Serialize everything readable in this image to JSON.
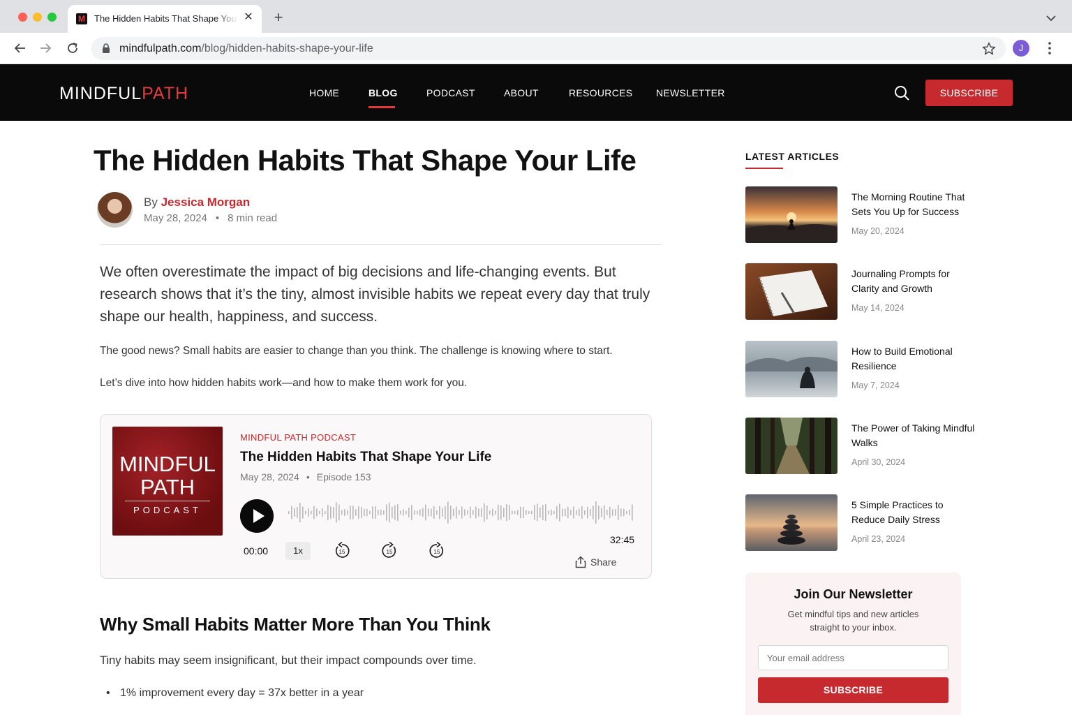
{
  "browser": {
    "tab_title": "The Hidden Habits That Shape Your Life",
    "tab_favicon": "M",
    "url_domain": "mindfulpath.com",
    "url_path": "/blog/hidden-habits-shape-your-life",
    "profile_initial": "J"
  },
  "site": {
    "logo_part1": "MINDFUL",
    "logo_part2": "PATH",
    "nav": [
      "HOME",
      "BLOG",
      "PODCAST",
      "ABOUT",
      "RESOURCES",
      "NEWSLETTER"
    ],
    "active_nav": "BLOG",
    "subscribe_label": "SUBSCRIBE",
    "accent_color": "#c62a2f"
  },
  "article": {
    "title": "The Hidden Habits That Shape Your Life",
    "by": "By",
    "author": "Jessica Morgan",
    "date": "May 28, 2024",
    "read_time": "8 min read",
    "lead": "We often overestimate the impact of big decisions and life-changing events. But research shows that it’s the tiny, almost invisible habits we repeat every day that truly shape our health, happiness, and success.",
    "para1": "The good news? Small habits are easier to change than you think. The challenge is knowing where to start.",
    "para2": "Let’s dive into how hidden habits work—and how to make them work for you.",
    "h2": "Why Small Habits Matter More Than You Think",
    "para3": "Tiny habits may seem insignificant, but their impact compounds over time.",
    "bullet1": "1% improvement every day = 37x better in a year"
  },
  "podcast": {
    "cover_line1": "MINDFUL",
    "cover_line2": "PATH",
    "cover_sub": "PODCAST",
    "label": "MINDFUL PATH PODCAST",
    "title": "The Hidden Habits That Shape Your Life",
    "date": "May 28, 2024",
    "episode": "Episode 153",
    "current_time": "00:00",
    "speed": "1x",
    "duration": "32:45",
    "share_label": "Share",
    "skip_back_seconds": "15",
    "skip_forward_seconds": "15"
  },
  "sidebar": {
    "heading": "LATEST ARTICLES",
    "articles": [
      {
        "title": "The Morning Routine That Sets You Up for Success",
        "date": "May 20, 2024"
      },
      {
        "title": "Journaling Prompts for Clarity and Growth",
        "date": "May 14, 2024"
      },
      {
        "title": "How to Build Emotional Resilience",
        "date": "May 7, 2024"
      },
      {
        "title": "The Power of Taking Mindful Walks",
        "date": "April 30, 2024"
      },
      {
        "title": "5 Simple Practices to Reduce Daily Stress",
        "date": "April 23, 2024"
      }
    ],
    "newsletter": {
      "title": "Join Our Newsletter",
      "description": "Get mindful tips and new articles straight to your inbox.",
      "placeholder": "Your email address",
      "button": "SUBSCRIBE"
    }
  }
}
